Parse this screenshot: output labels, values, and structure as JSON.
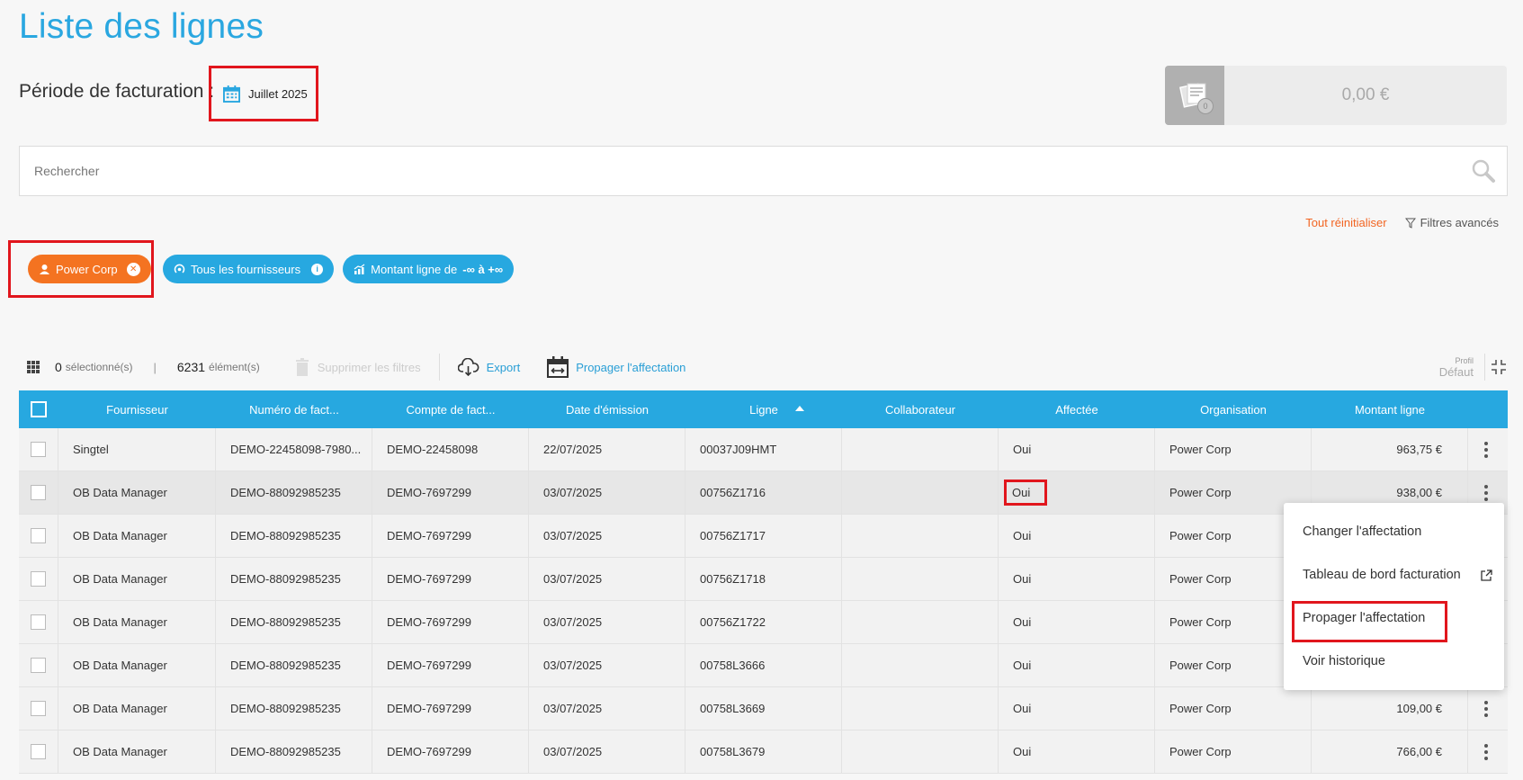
{
  "page": {
    "title": "Liste des lignes"
  },
  "period": {
    "label": "Période de facturation :",
    "value": "Juillet 2025"
  },
  "amount": {
    "badge": "0",
    "value": "0,00 €"
  },
  "search": {
    "placeholder": "Rechercher"
  },
  "filters": {
    "reset": "Tout réinitialiser",
    "advanced": "Filtres avancés"
  },
  "chips": {
    "org": "Power Corp",
    "suppliers": "Tous les fournisseurs",
    "amount_prefix": "Montant ligne de",
    "amount_range": "-∞ à +∞"
  },
  "toolbar": {
    "selected_count": "0",
    "selected_label": "sélectionné(s)",
    "separator": "|",
    "items_count": "6231",
    "items_label": "élément(s)",
    "delete_filters": "Supprimer les filtres",
    "export": "Export",
    "propagate": "Propager l'affectation",
    "profile_label": "Profil",
    "profile_value": "Défaut"
  },
  "table": {
    "columns": [
      "Fournisseur",
      "Numéro de fact...",
      "Compte de fact...",
      "Date d'émission",
      "Ligne",
      "Collaborateur",
      "Affectée",
      "Organisation",
      "Montant ligne"
    ],
    "rows": [
      [
        "Singtel",
        "DEMO-22458098-7980...",
        "DEMO-22458098",
        "22/07/2025",
        "00037J09HMT",
        "",
        "Oui",
        "Power Corp",
        "963,75 €"
      ],
      [
        "OB Data Manager",
        "DEMO-88092985235",
        "DEMO-7697299",
        "03/07/2025",
        "00756Z1716",
        "",
        "Oui",
        "Power Corp",
        "938,00 €"
      ],
      [
        "OB Data Manager",
        "DEMO-88092985235",
        "DEMO-7697299",
        "03/07/2025",
        "00756Z1717",
        "",
        "Oui",
        "Power Corp",
        ""
      ],
      [
        "OB Data Manager",
        "DEMO-88092985235",
        "DEMO-7697299",
        "03/07/2025",
        "00756Z1718",
        "",
        "Oui",
        "Power Corp",
        ""
      ],
      [
        "OB Data Manager",
        "DEMO-88092985235",
        "DEMO-7697299",
        "03/07/2025",
        "00756Z1722",
        "",
        "Oui",
        "Power Corp",
        ""
      ],
      [
        "OB Data Manager",
        "DEMO-88092985235",
        "DEMO-7697299",
        "03/07/2025",
        "00758L3666",
        "",
        "Oui",
        "Power Corp",
        ""
      ],
      [
        "OB Data Manager",
        "DEMO-88092985235",
        "DEMO-7697299",
        "03/07/2025",
        "00758L3669",
        "",
        "Oui",
        "Power Corp",
        "109,00 €"
      ],
      [
        "OB Data Manager",
        "DEMO-88092985235",
        "DEMO-7697299",
        "03/07/2025",
        "00758L3679",
        "",
        "Oui",
        "Power Corp",
        "766,00 €"
      ]
    ]
  },
  "context_menu": {
    "items": [
      "Changer l'affectation",
      "Tableau de bord facturation",
      "Propager l'affectation",
      "Voir historique"
    ]
  },
  "colors": {
    "accent": "#27a8e0",
    "orange": "#f47321",
    "highlight": "#e1161d"
  }
}
